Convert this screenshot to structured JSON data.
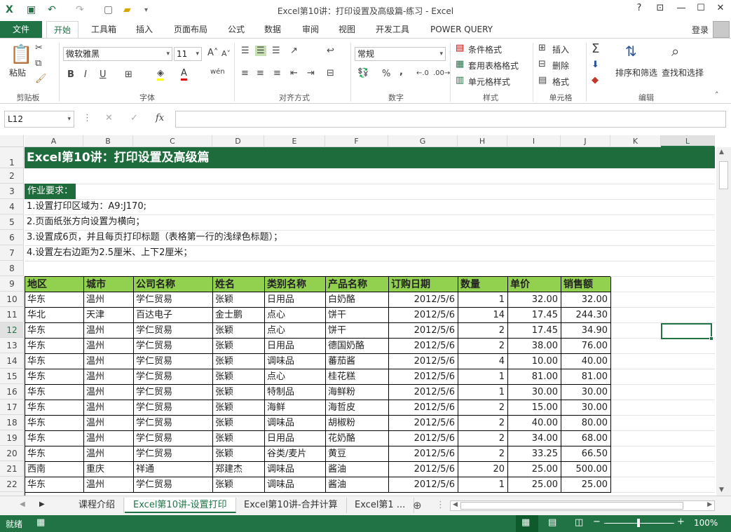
{
  "window": {
    "title": "Excel第10讲：打印设置及高级篇-练习 - Excel",
    "help": "?",
    "min": "—",
    "max": "☐",
    "close": "✕"
  },
  "tabs": {
    "file": "文件",
    "items": [
      "开始",
      "工具箱",
      "插入",
      "页面布局",
      "公式",
      "数据",
      "审阅",
      "视图",
      "开发工具",
      "POWER QUERY"
    ],
    "login": "登录"
  },
  "ribbon": {
    "clipboard": {
      "paste": "粘贴",
      "label": "剪贴板"
    },
    "font": {
      "name": "微软雅黑",
      "size": "11",
      "bold": "B",
      "italic": "I",
      "underline": "U",
      "wen": "wén",
      "label": "字体"
    },
    "alignment": {
      "label": "对齐方式"
    },
    "number": {
      "format": "常规",
      "percent": "%",
      "comma": ",",
      "label": "数字"
    },
    "styles": {
      "cond": "条件格式",
      "table": "套用表格格式",
      "cell": "单元格样式",
      "label": "样式"
    },
    "cells": {
      "insert": "插入",
      "delete": "删除",
      "format": "格式",
      "label": "单元格"
    },
    "editing": {
      "sort": "排序和筛选",
      "find": "查找和选择",
      "label": "编辑"
    }
  },
  "formula": {
    "namebox": "L12",
    "fx": "fx"
  },
  "columns": [
    "A",
    "B",
    "C",
    "D",
    "E",
    "F",
    "G",
    "H",
    "I",
    "J",
    "K",
    "L"
  ],
  "rows": [
    "1",
    "2",
    "3",
    "4",
    "5",
    "6",
    "7",
    "8",
    "9",
    "10",
    "11",
    "12",
    "13",
    "14",
    "15",
    "16",
    "17",
    "18",
    "19",
    "20",
    "21",
    "22"
  ],
  "sheet": {
    "title": "Excel第10讲：打印设置及高级篇",
    "req_label": "作业要求：",
    "req": [
      "1.设置打印区域为：A9:J170;",
      "2.页面纸张方向设置为横向；",
      "3.设置成6页，并且每页打印标题（表格第一行的浅绿色标题）；",
      "4.设置左右边距为2.5厘米、上下2厘米；"
    ],
    "headers": [
      "地区",
      "城市",
      "公司名称",
      "姓名",
      "类别名称",
      "产品名称",
      "订购日期",
      "数量",
      "单价",
      "销售额"
    ],
    "data": [
      [
        "华东",
        "温州",
        "学仁贸易",
        "张颖",
        "日用品",
        "白奶酪",
        "2012/5/6",
        "1",
        "32.00",
        "32.00"
      ],
      [
        "华北",
        "天津",
        "百达电子",
        "金士鹏",
        "点心",
        "饼干",
        "2012/5/6",
        "14",
        "17.45",
        "244.30"
      ],
      [
        "华东",
        "温州",
        "学仁贸易",
        "张颖",
        "点心",
        "饼干",
        "2012/5/6",
        "2",
        "17.45",
        "34.90"
      ],
      [
        "华东",
        "温州",
        "学仁贸易",
        "张颖",
        "日用品",
        "德国奶酪",
        "2012/5/6",
        "2",
        "38.00",
        "76.00"
      ],
      [
        "华东",
        "温州",
        "学仁贸易",
        "张颖",
        "调味品",
        "蕃茄酱",
        "2012/5/6",
        "4",
        "10.00",
        "40.00"
      ],
      [
        "华东",
        "温州",
        "学仁贸易",
        "张颖",
        "点心",
        "桂花糕",
        "2012/5/6",
        "1",
        "81.00",
        "81.00"
      ],
      [
        "华东",
        "温州",
        "学仁贸易",
        "张颖",
        "特制品",
        "海鲜粉",
        "2012/5/6",
        "1",
        "30.00",
        "30.00"
      ],
      [
        "华东",
        "温州",
        "学仁贸易",
        "张颖",
        "海鲜",
        "海哲皮",
        "2012/5/6",
        "2",
        "15.00",
        "30.00"
      ],
      [
        "华东",
        "温州",
        "学仁贸易",
        "张颖",
        "调味品",
        "胡椒粉",
        "2012/5/6",
        "2",
        "40.00",
        "80.00"
      ],
      [
        "华东",
        "温州",
        "学仁贸易",
        "张颖",
        "日用品",
        "花奶酪",
        "2012/5/6",
        "2",
        "34.00",
        "68.00"
      ],
      [
        "华东",
        "温州",
        "学仁贸易",
        "张颖",
        "谷类/麦片",
        "黄豆",
        "2012/5/6",
        "2",
        "33.25",
        "66.50"
      ],
      [
        "西南",
        "重庆",
        "祥通",
        "郑建杰",
        "调味品",
        "酱油",
        "2012/5/6",
        "20",
        "25.00",
        "500.00"
      ],
      [
        "华东",
        "温州",
        "学仁贸易",
        "张颖",
        "调味品",
        "酱油",
        "2012/5/6",
        "1",
        "25.00",
        "25.00"
      ]
    ]
  },
  "sheettabs": [
    "课程介绍",
    "Excel第10讲-设置打印",
    "Excel第10讲-合并计算",
    "Excel第1 ..."
  ],
  "status": {
    "ready": "就绪",
    "zoom": "100%"
  },
  "colors": {
    "accent": "#217346",
    "header_green": "#92d050",
    "title_green": "#1e6b3c"
  }
}
